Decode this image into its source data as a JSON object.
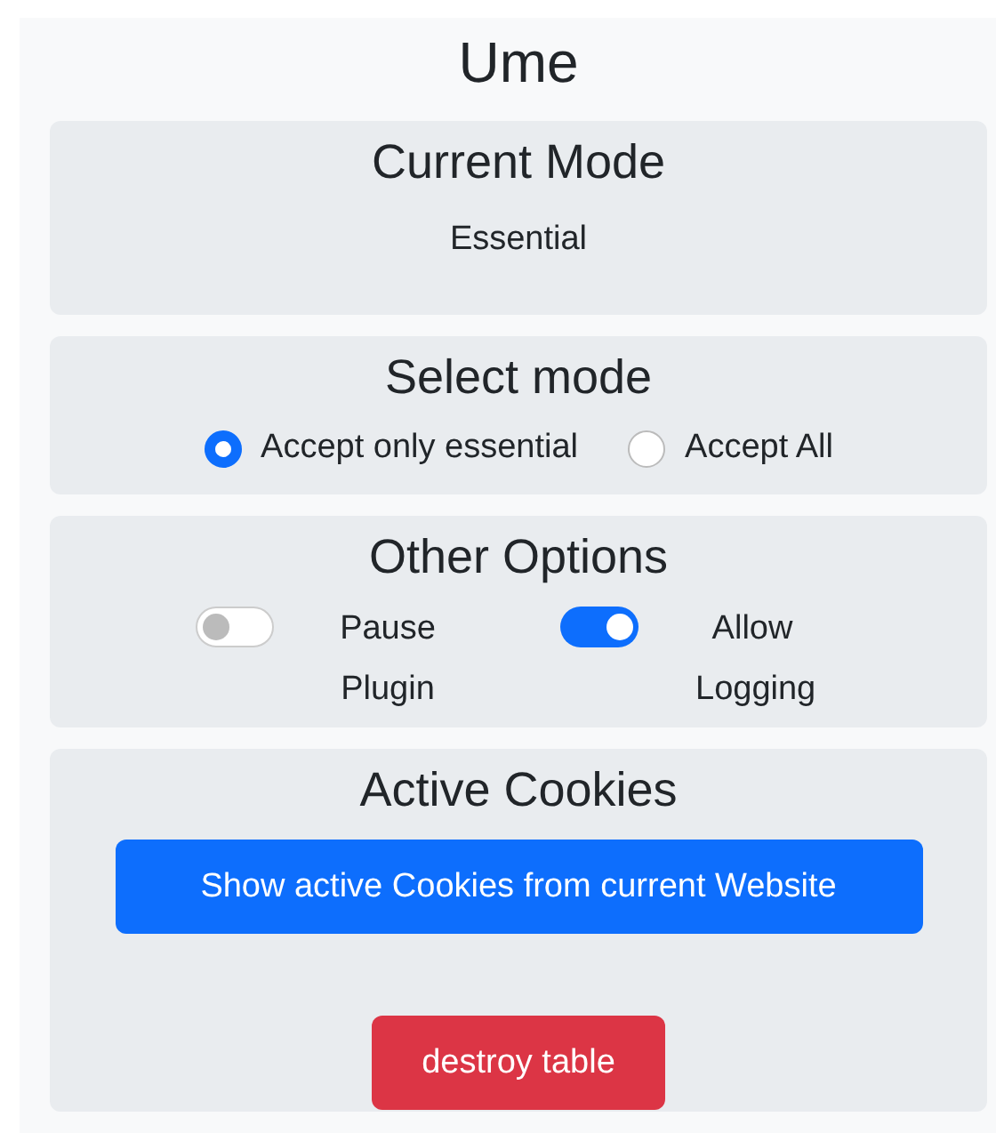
{
  "title": "Ume",
  "sections": [
    {
      "kind": "status",
      "heading": "Current Mode",
      "value": "Essential"
    },
    {
      "kind": "radios",
      "heading": "Select mode",
      "options": [
        {
          "label": "Accept only essential",
          "selected": true
        },
        {
          "label": "Accept All",
          "selected": false
        }
      ]
    },
    {
      "kind": "switches",
      "heading": "Other Options",
      "switches": [
        {
          "label": "Pause Plugin",
          "on": false
        },
        {
          "label": "Allow Logging",
          "on": true
        }
      ]
    },
    {
      "kind": "actions",
      "heading": "Active Cookies",
      "buttons": [
        {
          "label": "Show active Cookies from current Website",
          "kind": "primary"
        },
        {
          "label": "destroy table",
          "kind": "danger"
        }
      ]
    }
  ]
}
